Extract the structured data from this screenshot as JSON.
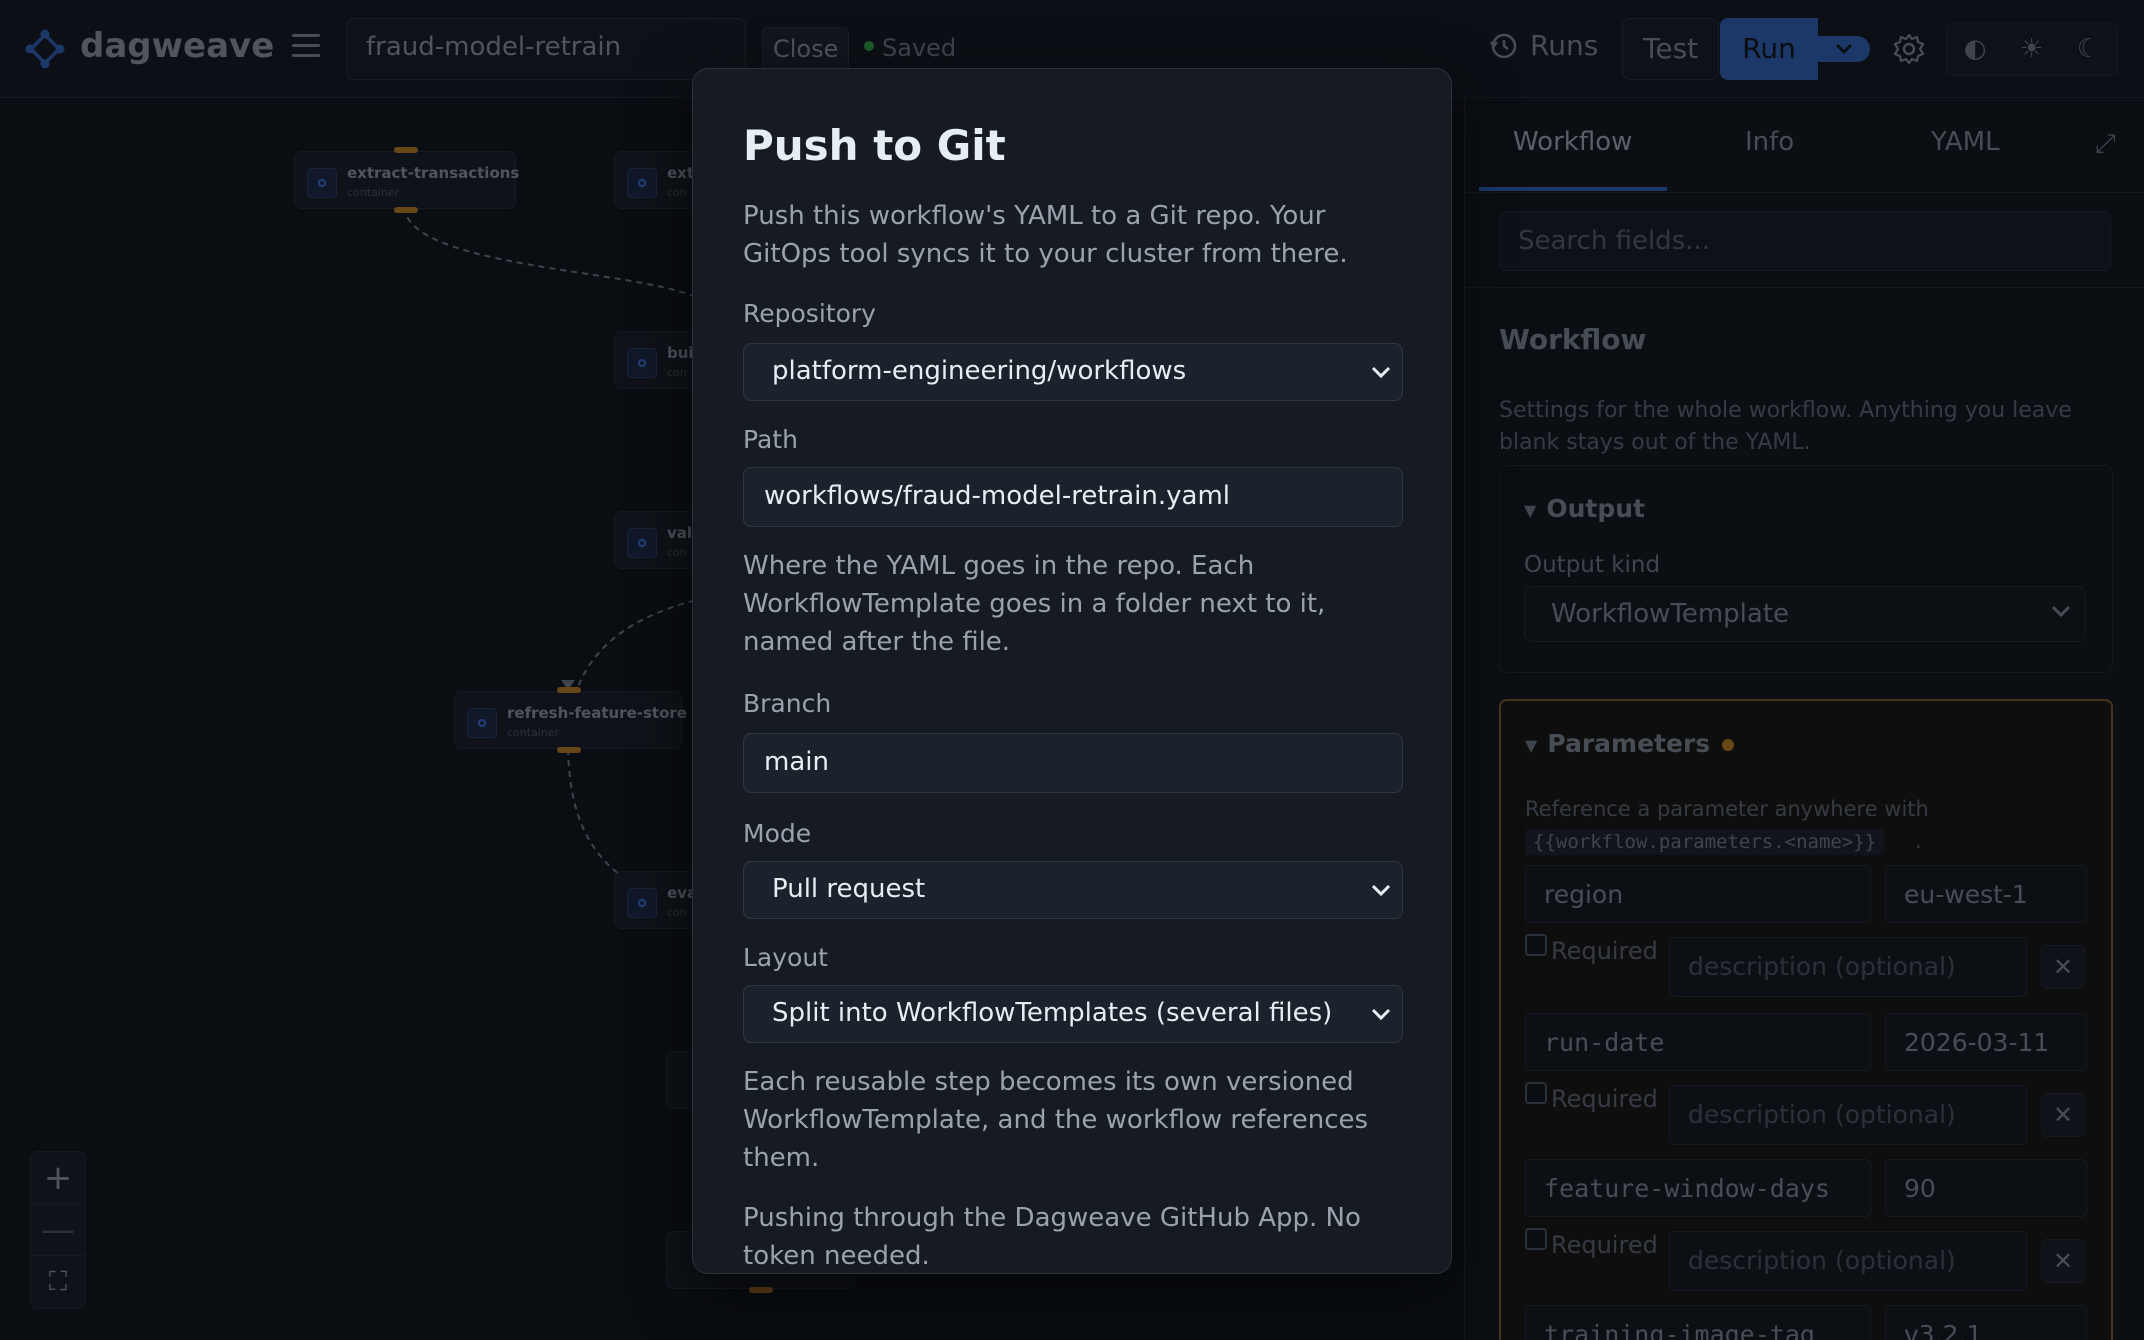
{
  "header": {
    "brand": "dagweave",
    "workflow_name": "fraud-model-retrain",
    "close_label": "Close",
    "saved_label": "Saved",
    "runs_label": "Runs",
    "test_label": "Test",
    "run_label": "Run",
    "theme_icons": [
      "contrast-icon",
      "sun-icon",
      "moon-icon"
    ]
  },
  "canvas": {
    "nodes": [
      {
        "title": "extract-transactions",
        "kind": "container"
      },
      {
        "title": "ext",
        "kind": "con"
      },
      {
        "title": "bui",
        "kind": "con"
      },
      {
        "title": "vali",
        "kind": "con"
      },
      {
        "title": "refresh-feature-store",
        "kind": "container"
      },
      {
        "title": "eva",
        "kind": "con"
      }
    ],
    "zoom": {
      "in": "+",
      "out": "—",
      "fit": "⛶"
    }
  },
  "panel": {
    "tabs": [
      "Workflow",
      "Info",
      "YAML"
    ],
    "active_tab": "Workflow",
    "search_placeholder": "Search fields...",
    "section_title": "Workflow",
    "section_desc": "Settings for the whole workflow. Anything you leave blank stays out of the YAML.",
    "output": {
      "title": "Output",
      "kind_label": "Output kind",
      "kind_value": "WorkflowTemplate"
    },
    "parameters": {
      "title": "Parameters",
      "ref_text": "Reference a parameter anywhere with",
      "ref_code": "{{workflow.parameters.<name>}}",
      "ref_suffix": ".",
      "required_label": "Required",
      "description_placeholder": "description (optional)",
      "remove_symbol": "✕",
      "items": [
        {
          "name": "region",
          "value": "eu-west-1"
        },
        {
          "name": "run-date",
          "value": "2026-03-11"
        },
        {
          "name": "feature-window-days",
          "value": "90"
        },
        {
          "name": "training-image-tag",
          "value": "v3.2.1"
        }
      ]
    }
  },
  "modal": {
    "title": "Push to Git",
    "description": "Push this workflow's YAML to a Git repo. Your GitOps tool syncs it to your cluster from there.",
    "repository_label": "Repository",
    "repository_value": "platform-engineering/workflows",
    "path_label": "Path",
    "path_value": "workflows/fraud-model-retrain.yaml",
    "path_help": "Where the YAML goes in the repo. Each WorkflowTemplate goes in a folder next to it, named after the file.",
    "branch_label": "Branch",
    "branch_value": "main",
    "mode_label": "Mode",
    "mode_value": "Pull request",
    "layout_label": "Layout",
    "layout_value": "Split into WorkflowTemplates (several files)",
    "layout_help": "Each reusable step becomes its own versioned WorkflowTemplate, and the workflow references them.",
    "auth_note": "Pushing through the Dagweave GitHub App. No token needed."
  },
  "colors": {
    "accent": "#2f5fb3",
    "saved": "#2ea043",
    "port": "#b7791f",
    "background": "#0d1117"
  }
}
